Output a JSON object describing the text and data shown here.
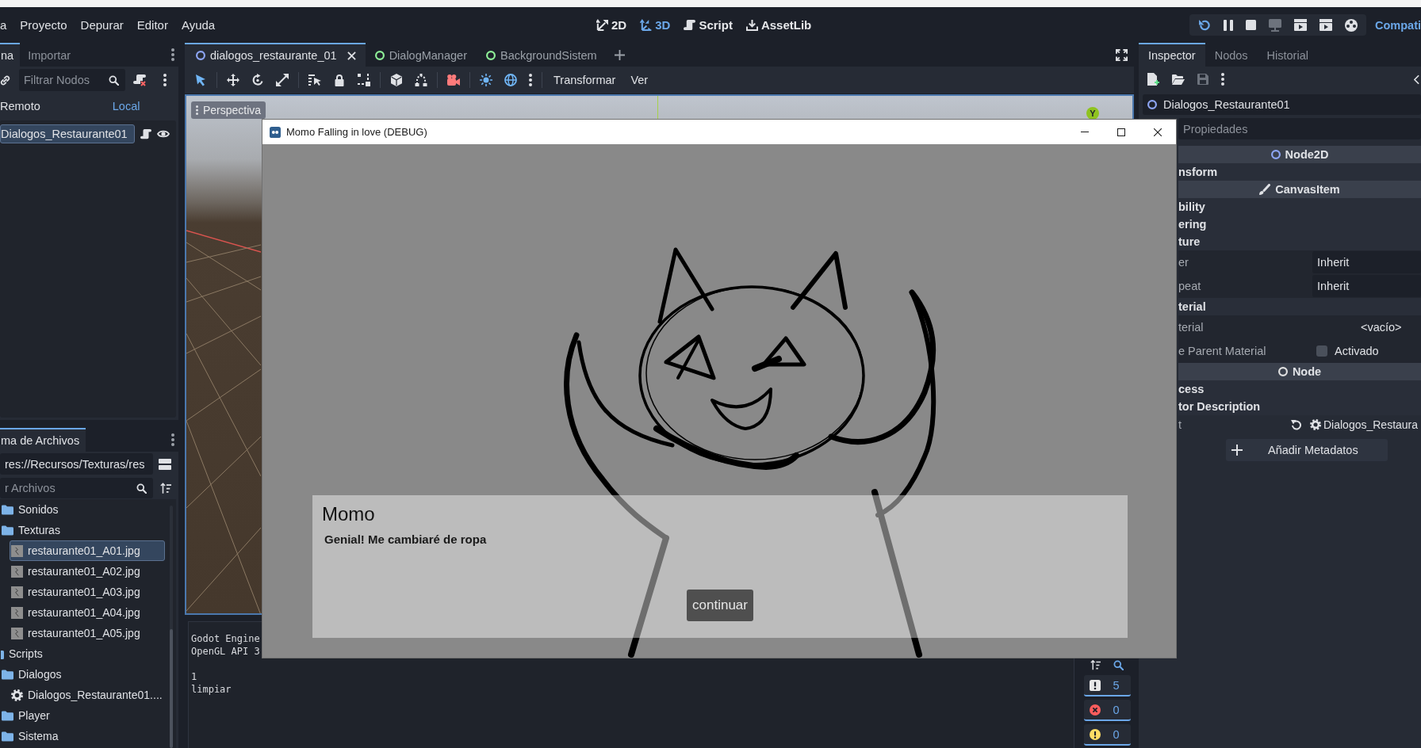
{
  "menu_bar": {
    "menus": [
      "a",
      "Proyecto",
      "Depurar",
      "Editor",
      "Ayuda"
    ],
    "workspaces": [
      {
        "kind": "canvas",
        "label": "2D",
        "selected": false
      },
      {
        "kind": "spatial",
        "label": "3D",
        "selected": true
      },
      {
        "kind": "script",
        "label": "Script",
        "selected": false
      },
      {
        "kind": "assetlib",
        "label": "AssetLib",
        "selected": false
      }
    ],
    "renderer": "Compati"
  },
  "scene_dock": {
    "tabs": [
      {
        "label": "na",
        "selected": true
      },
      {
        "label": "Importar",
        "selected": false
      }
    ],
    "filter": {
      "placeholder": "Filtrar Nodos"
    },
    "modes": [
      {
        "label": "Remoto",
        "selected": false
      },
      {
        "label": "Local",
        "selected": true
      }
    ],
    "tree": [
      {
        "label": "Dialogos_Restaurante01",
        "selected": true
      }
    ]
  },
  "filesystem_dock": {
    "tabs": [
      {
        "label": "ma de Archivos",
        "selected": true
      }
    ],
    "path": "res://Recursos/Texturas/res",
    "filter": {
      "placeholder": "r Archivos"
    },
    "tree": [
      {
        "children": [
          {
            "kind": "folder",
            "label": "Sonidos",
            "selected": false
          },
          {
            "kind": "folder",
            "label": "Texturas",
            "selected": false,
            "children": [
              {
                "kind": "image",
                "label": "restaurante01_A01.jpg",
                "selected": true
              },
              {
                "kind": "image",
                "label": "restaurante01_A02.jpg",
                "selected": false
              },
              {
                "kind": "image",
                "label": "restaurante01_A03.jpg",
                "selected": false
              },
              {
                "kind": "image",
                "label": "restaurante01_A04.jpg",
                "selected": false
              },
              {
                "kind": "image",
                "label": "restaurante01_A05.jpg",
                "selected": false
              }
            ]
          }
        ]
      },
      {
        "kind": "folder",
        "label": "Scripts",
        "selected": false,
        "children": [
          {
            "kind": "folder",
            "label": "Dialogos",
            "selected": false,
            "children": [
              {
                "kind": "script",
                "label": "Dialogos_Restaurante01....",
                "selected": false
              }
            ]
          },
          {
            "kind": "folder",
            "label": "Player",
            "selected": false
          },
          {
            "kind": "folder",
            "label": "Sistema",
            "selected": false
          }
        ]
      }
    ]
  },
  "scene_tabs": [
    {
      "label": "dialogos_restaurante_01",
      "selected": true,
      "color": "#8da5f3"
    },
    {
      "label": "DialogManager",
      "selected": false,
      "color": "#8eef97"
    },
    {
      "label": "BackgroundSistem",
      "selected": false,
      "color": "#8eef97"
    }
  ],
  "viewport_toolbar": {
    "menus": [
      "Transformar",
      "Ver"
    ]
  },
  "viewport": {
    "view_menu": "Perspectiva",
    "gizmo_axis": "Y"
  },
  "output": {
    "blocks": [
      [
        "Godot Engine",
        "OpenGL API 3"
      ],
      [
        "1",
        "limpiar"
      ]
    ],
    "counters": [
      {
        "kind": "message",
        "count": "5"
      },
      {
        "kind": "error",
        "count": "0"
      },
      {
        "kind": "warning",
        "count": "0"
      }
    ]
  },
  "inspector": {
    "tabs": [
      {
        "label": "Inspector",
        "selected": true
      },
      {
        "label": "Nodos",
        "selected": false
      },
      {
        "label": "Historial",
        "selected": false
      }
    ],
    "object": "Dialogos_Restaurante01",
    "filter": {
      "placeholder": "Propiedades"
    },
    "categories": [
      {
        "kind": "ring",
        "label": "Node2D",
        "color": "#8da5f3",
        "children": [
          {
            "kind": "section",
            "label": "nsform"
          }
        ]
      },
      {
        "kind": "brush",
        "label": "CanvasItem",
        "children": [
          {
            "kind": "section",
            "label": "bility"
          },
          {
            "kind": "section",
            "label": "ering"
          },
          {
            "kind": "section",
            "label": "ture",
            "children": [
              {
                "kind": "property",
                "label": "er",
                "value": "Inherit"
              },
              {
                "kind": "property",
                "label": "peat",
                "value": "Inherit"
              }
            ]
          },
          {
            "kind": "section",
            "label": "terial",
            "children": [
              {
                "kind": "resource",
                "label": "terial",
                "value": "<vacío>"
              },
              {
                "kind": "check",
                "label": "e Parent Material",
                "text": "Activado",
                "checked": false
              }
            ]
          }
        ]
      },
      {
        "kind": "ring",
        "label": "Node",
        "color": "#e0e0e0",
        "children": [
          {
            "kind": "section",
            "label": "cess"
          },
          {
            "kind": "section",
            "label": "tor Description"
          },
          {
            "kind": "script",
            "label": "t",
            "value": "Dialogos_Restaura"
          }
        ]
      }
    ],
    "add_button": "Añadir Metadatos"
  },
  "game_window": {
    "title": "Momo Falling in love (DEBUG)",
    "dialog": {
      "speaker": "Momo",
      "text": "Genial! Me cambiaré de ropa",
      "button": "continuar"
    }
  }
}
